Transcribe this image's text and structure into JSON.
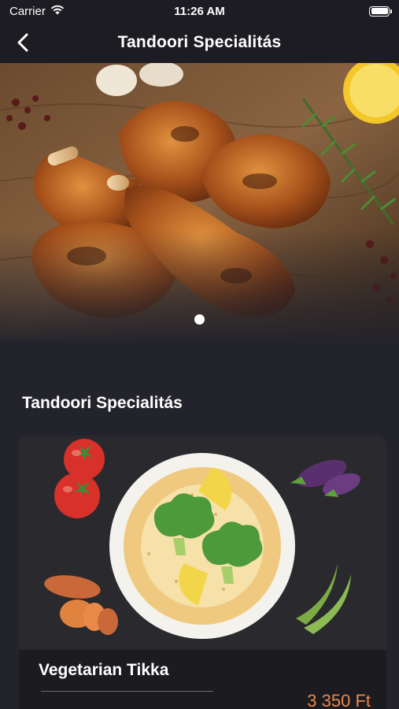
{
  "status_bar": {
    "carrier": "Carrier",
    "time": "11:26 AM",
    "battery_level": 1.0
  },
  "nav": {
    "title": "Tandoori Specialitás",
    "back_icon": "chevron-left-icon"
  },
  "hero": {
    "image": "roasted-chicken-drumsticks",
    "page_count": 1,
    "current_page": 1
  },
  "section": {
    "title": "Tandoori Specialitás"
  },
  "products": [
    {
      "name": "Vegetarian Tikka",
      "price": "3 350 Ft",
      "image": "vegetable-rice-plate"
    }
  ],
  "colors": {
    "background": "#23232b",
    "bar": "#1c1c22",
    "card": "#2e2e34",
    "price": "#e98a4a"
  }
}
